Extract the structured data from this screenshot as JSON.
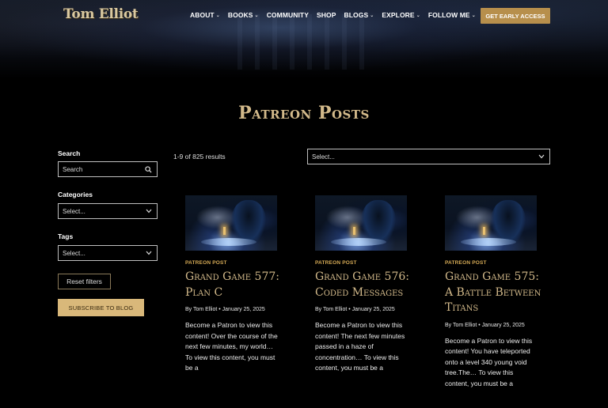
{
  "brand": {
    "logo": "Tom Elliot"
  },
  "nav": {
    "items": [
      {
        "label": "ABOUT",
        "dropdown": true
      },
      {
        "label": "BOOKS",
        "dropdown": true
      },
      {
        "label": "COMMUNITY",
        "dropdown": false
      },
      {
        "label": "SHOP",
        "dropdown": false
      },
      {
        "label": "BLOGS",
        "dropdown": true
      },
      {
        "label": "EXPLORE",
        "dropdown": true
      },
      {
        "label": "FOLLOW ME",
        "dropdown": true
      }
    ],
    "cta": "GET EARLY ACCESS"
  },
  "page": {
    "title": "Patreon Posts"
  },
  "sidebar": {
    "search_label": "Search",
    "search_placeholder": "Search",
    "categories_label": "Categories",
    "categories_value": "Select...",
    "tags_label": "Tags",
    "tags_value": "Select...",
    "reset": "Reset filters",
    "subscribe": "SUBSCRIBE TO BLOG"
  },
  "results": {
    "count": "1-9 of 825 results",
    "sort_value": "Select..."
  },
  "posts": [
    {
      "category": "PATREON POST",
      "title": "Grand Game 577: Plan C",
      "meta": "By Tom Elliot • January 25, 2025",
      "excerpt": "Become a Patron to view this content! Over the course of the next few minutes, my world… To view this content, you must be a"
    },
    {
      "category": "PATREON POST",
      "title": "Grand Game 576: Coded Messages",
      "meta": "By Tom Elliot • January 25, 2025",
      "excerpt": "Become a Patron to view this content! The next few minutes passed in a haze of concentration… To view this content, you must be a"
    },
    {
      "category": "PATREON POST",
      "title": "Grand Game 575: A Battle Between Titans",
      "meta": "By Tom Elliot • January 25, 2025",
      "excerpt": "Become a Patron to view this content! You have teleported onto a level 340 young void tree.The… To view this content, you must be a"
    }
  ],
  "icons": {
    "search": "search-icon",
    "chevron": "chevron-down-icon"
  },
  "colors": {
    "accent_gold": "#d2b98a",
    "cta_bg": "#b78f4c",
    "subscribe_bg": "#d9b87a",
    "tag_color": "#d4a955",
    "background": "#000000"
  }
}
